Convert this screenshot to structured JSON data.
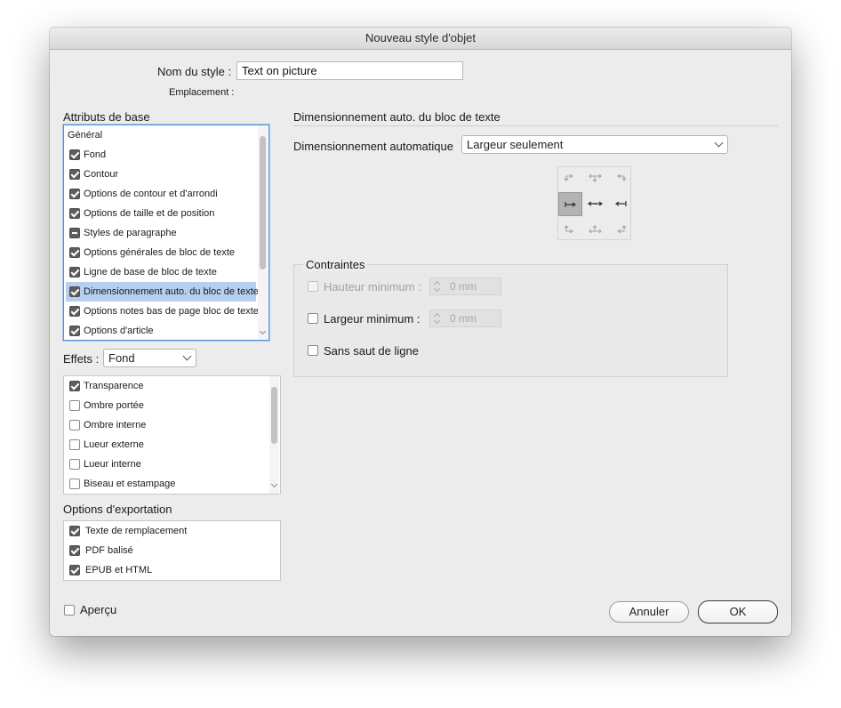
{
  "dialog": {
    "title": "Nouveau style d'objet",
    "style_name_label": "Nom du style :",
    "style_name_value": "Text on picture",
    "location_label": "Emplacement :"
  },
  "basic_attributes": {
    "title": "Attributs de base",
    "header": "Général",
    "items": [
      {
        "label": "Fond",
        "state": "checked"
      },
      {
        "label": "Contour",
        "state": "checked"
      },
      {
        "label": "Options de contour et d'arrondi",
        "state": "checked"
      },
      {
        "label": "Options de taille et de position",
        "state": "checked"
      },
      {
        "label": "Styles de paragraphe",
        "state": "mixed"
      },
      {
        "label": "Options générales de bloc de texte",
        "state": "checked"
      },
      {
        "label": "Ligne de base de bloc de texte",
        "state": "checked"
      },
      {
        "label": "Dimensionnement auto. du bloc de texte",
        "state": "checked",
        "selected": true
      },
      {
        "label": "Options notes bas de page bloc de texte",
        "state": "checked"
      },
      {
        "label": "Options d'article",
        "state": "checked"
      }
    ]
  },
  "effects": {
    "label": "Effets :",
    "select_value": "Fond",
    "items": [
      {
        "label": "Transparence",
        "state": "checked"
      },
      {
        "label": "Ombre portée",
        "state": "unchecked"
      },
      {
        "label": "Ombre interne",
        "state": "unchecked"
      },
      {
        "label": "Lueur externe",
        "state": "unchecked"
      },
      {
        "label": "Lueur interne",
        "state": "unchecked"
      },
      {
        "label": "Biseau et estampage",
        "state": "unchecked"
      }
    ]
  },
  "export_options": {
    "title": "Options d'exportation",
    "items": [
      {
        "label": "Texte de remplacement",
        "state": "checked"
      },
      {
        "label": "PDF balisé",
        "state": "checked"
      },
      {
        "label": "EPUB et HTML",
        "state": "checked"
      }
    ]
  },
  "panel": {
    "title": "Dimensionnement auto. du bloc de texte",
    "auto_sizing_label": "Dimensionnement automatique",
    "auto_sizing_value": "Largeur seulement",
    "reference_point_active": "middle-left"
  },
  "constraints": {
    "title": "Contraintes",
    "min_height_label": "Hauteur minimum :",
    "min_height_value": "0 mm",
    "min_width_label": "Largeur minimum :",
    "min_width_value": "0 mm",
    "no_line_break_label": "Sans saut de ligne"
  },
  "footer": {
    "preview_label": "Aperçu",
    "cancel_label": "Annuler",
    "ok_label": "OK"
  },
  "colors": {
    "selection": "#b5d0ef",
    "focus_ring": "#5b8fd6",
    "dialog_bg": "#ececec"
  }
}
